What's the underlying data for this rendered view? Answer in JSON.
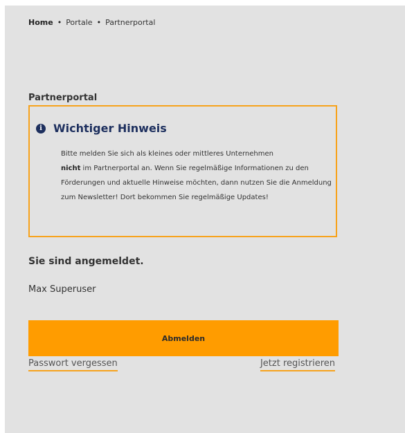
{
  "breadcrumb": {
    "home": "Home",
    "sep": "•",
    "portale": "Portale",
    "current": "Partnerportal"
  },
  "section_title": "Partnerportal",
  "notice": {
    "icon": "info-circle-icon",
    "title": "Wichtiger Hinweis",
    "body_part1": "Bitte melden Sie sich als kleines oder mittleres Unternehmen",
    "body_bold": "nicht",
    "body_part2": " im Partnerportal an. Wenn Sie regelmäßige Informationen zu den Förderungen und aktuelle Hinweise möchten, dann nutzen Sie die Anmeldung zum Newsletter! Dort bekommen Sie regelmäßige Updates!"
  },
  "status": {
    "logged_in": "Sie sind angemeldet.",
    "username": "Max Superuser"
  },
  "actions": {
    "logout": "Abmelden",
    "forgot_password": "Passwort vergessen",
    "register": "Jetzt registrieren"
  },
  "colors": {
    "accent": "#ff9c00",
    "border": "#f7a21b",
    "title_blue": "#1d2f5e",
    "panel_bg": "#e2e2e2"
  }
}
